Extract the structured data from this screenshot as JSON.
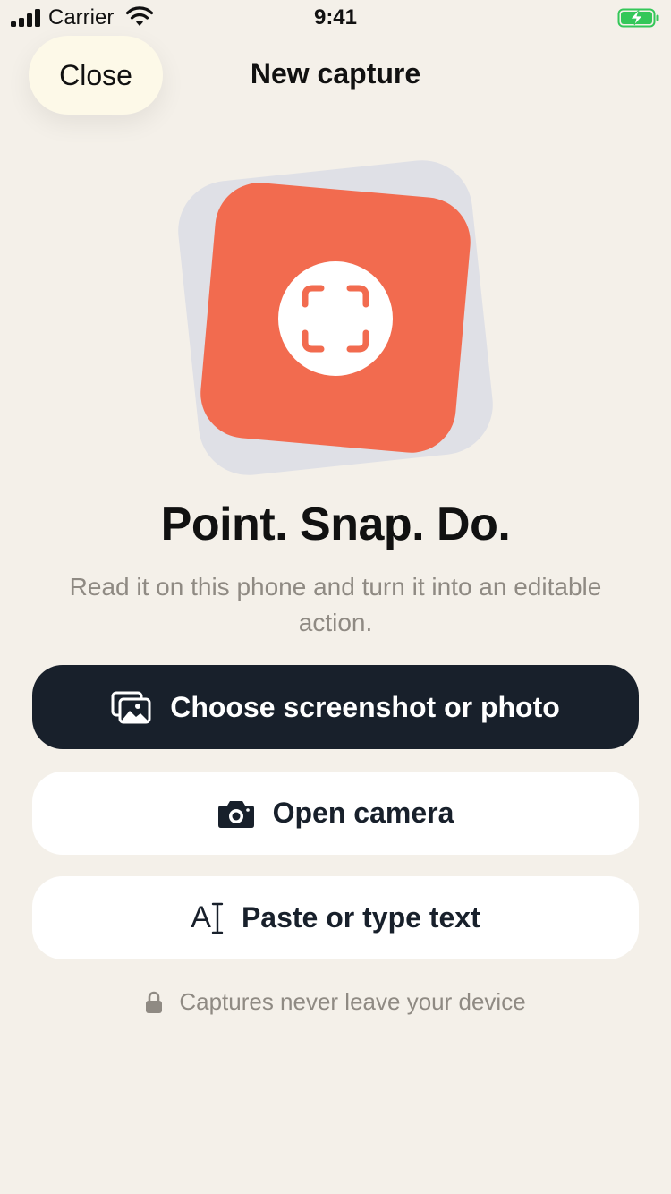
{
  "status_bar": {
    "carrier": "Carrier",
    "time": "9:41",
    "icons": [
      "signal-icon",
      "wifi-icon",
      "battery-charging-icon"
    ]
  },
  "nav": {
    "close_label": "Close",
    "title": "New capture"
  },
  "hero": {
    "icon": "scan-frame-icon",
    "headline": "Point. Snap. Do.",
    "subtext": "Read it on this phone and turn it into an editable action."
  },
  "actions": {
    "choose": {
      "label": "Choose screenshot or photo",
      "icon": "photo-stack-icon"
    },
    "camera": {
      "label": "Open camera",
      "icon": "camera-icon"
    },
    "paste": {
      "label": "Paste or type text",
      "icon_text": "A",
      "icon": "text-cursor-icon"
    }
  },
  "privacy_note": {
    "text": "Captures never leave your device",
    "icon": "lock-icon"
  },
  "colors": {
    "background": "#f4f0e9",
    "accent": "#f26b4f",
    "primary_button": "#18202b",
    "close_button": "#fdf9e8",
    "muted_text": "#8f8a83",
    "battery_green": "#34c759"
  }
}
